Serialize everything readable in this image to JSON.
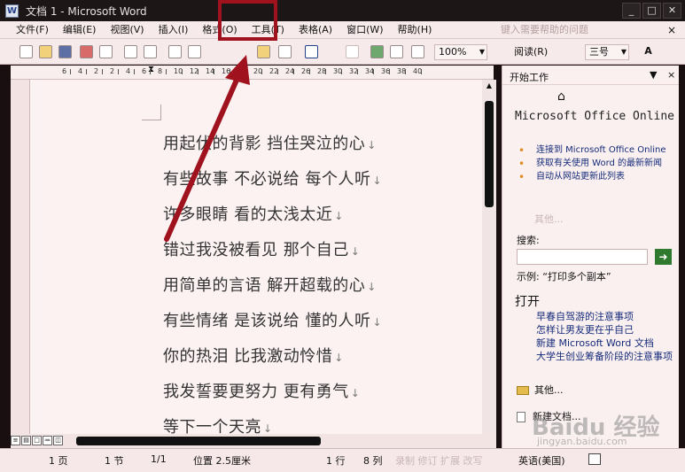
{
  "window": {
    "title": "文档 1 - Microsoft Word",
    "app_icon": "W",
    "controls": [
      "_",
      "□",
      "✕"
    ]
  },
  "menubar": {
    "items": [
      "文件(F)",
      "编辑(E)",
      "视图(V)",
      "插入(I)",
      "格式(O)",
      "工具(T)",
      "表格(A)",
      "窗口(W)",
      "帮助(H)"
    ],
    "help_search_placeholder": "键入需要帮助的问题",
    "close": "×"
  },
  "toolbar": {
    "zoom": "100%",
    "read_label": "阅读(R)",
    "font_size": "三号"
  },
  "ruler": {
    "numbers": [
      "6",
      "4",
      "2",
      "2",
      "4",
      "6",
      "8",
      "10",
      "12",
      "14",
      "16",
      "18",
      "20",
      "22",
      "24",
      "26",
      "28",
      "30",
      "32",
      "34",
      "36",
      "38",
      "40"
    ]
  },
  "document": {
    "lines": [
      "用起伏的背影 挡住哭泣的心",
      "有些故事 不必说给 每个人听",
      "许多眼睛 看的太浅太近",
      "错过我没被看见 那个自己",
      "用简单的言语 解开超载的心",
      "有些情绪 是该说给 懂的人听",
      "你的热泪 比我激动怜惜",
      "我发誓要更努力 更有勇气",
      "等下一个天亮"
    ],
    "paragraph_mark": "↓"
  },
  "statusbar": {
    "page": "1 页",
    "section": "1 节",
    "page_of": "1/1",
    "position": "位置 2.5厘米",
    "line": "1 行",
    "column": "8 列",
    "modes": "录制 修订 扩展 改写",
    "language": "英语(美国)"
  },
  "taskpane": {
    "title": "开始工作",
    "office_online": "Microsoft Office Online",
    "links": [
      "连接到 Microsoft Office Online",
      "获取有关使用 Word 的最新新闻",
      "自动从网站更新此列表"
    ],
    "more": "其他...",
    "search_label": "搜索:",
    "search_go": "➜",
    "example": "示例: “打印多个副本”",
    "open_heading": "打开",
    "files": [
      "早春自驾游的注意事项",
      "怎样让男友更在乎自己",
      "新建 Microsoft Word 文档",
      "大学生创业筹备阶段的注意事项"
    ],
    "other_files": "其他...",
    "new_document": "新建文档..."
  },
  "watermark": {
    "brand": "Baidu 经验",
    "url": "jingyan.baidu.com"
  },
  "colors": {
    "highlight": "#a0121d",
    "toolbar_bg": "#f7eaea",
    "link": "#142b7a"
  }
}
